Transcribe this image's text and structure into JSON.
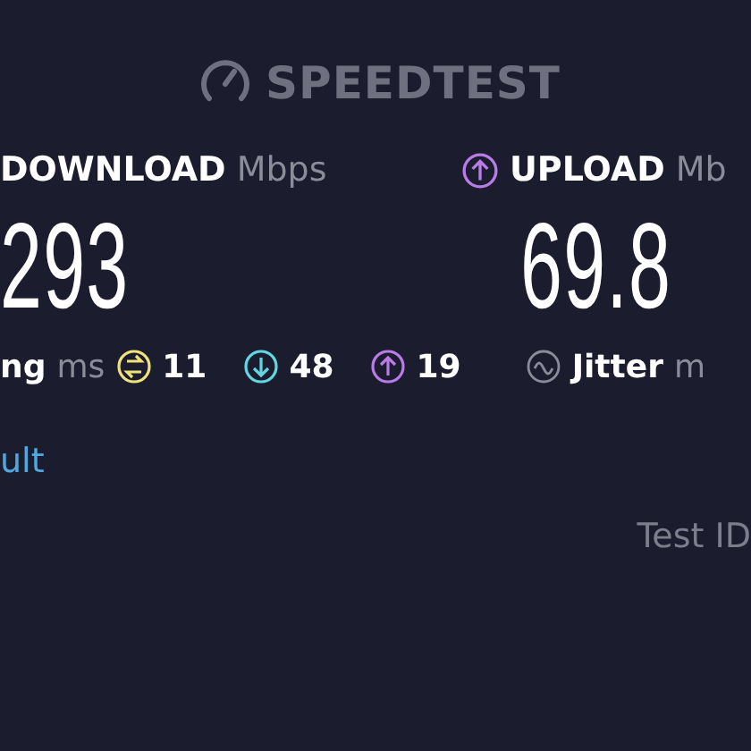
{
  "logo": {
    "text": "SPEEDTEST"
  },
  "results": [
    {
      "kind": "download",
      "label": "DOWNLOAD",
      "unit": "Mbps",
      "value": "293"
    },
    {
      "kind": "upload",
      "label": "UPLOAD",
      "unit": "Mb",
      "value": "69.8"
    }
  ],
  "ping": {
    "label": "ng",
    "unit": "ms",
    "items": [
      {
        "kind": "idle",
        "value": "11",
        "color": "#f0e27a"
      },
      {
        "kind": "down",
        "value": "48",
        "color": "#5fd8e3"
      },
      {
        "kind": "up",
        "value": "19",
        "color": "#b97be8"
      }
    ]
  },
  "jitter": {
    "label": "Jitter",
    "unit": "m"
  },
  "link": "ult",
  "test_id": "Test ID"
}
